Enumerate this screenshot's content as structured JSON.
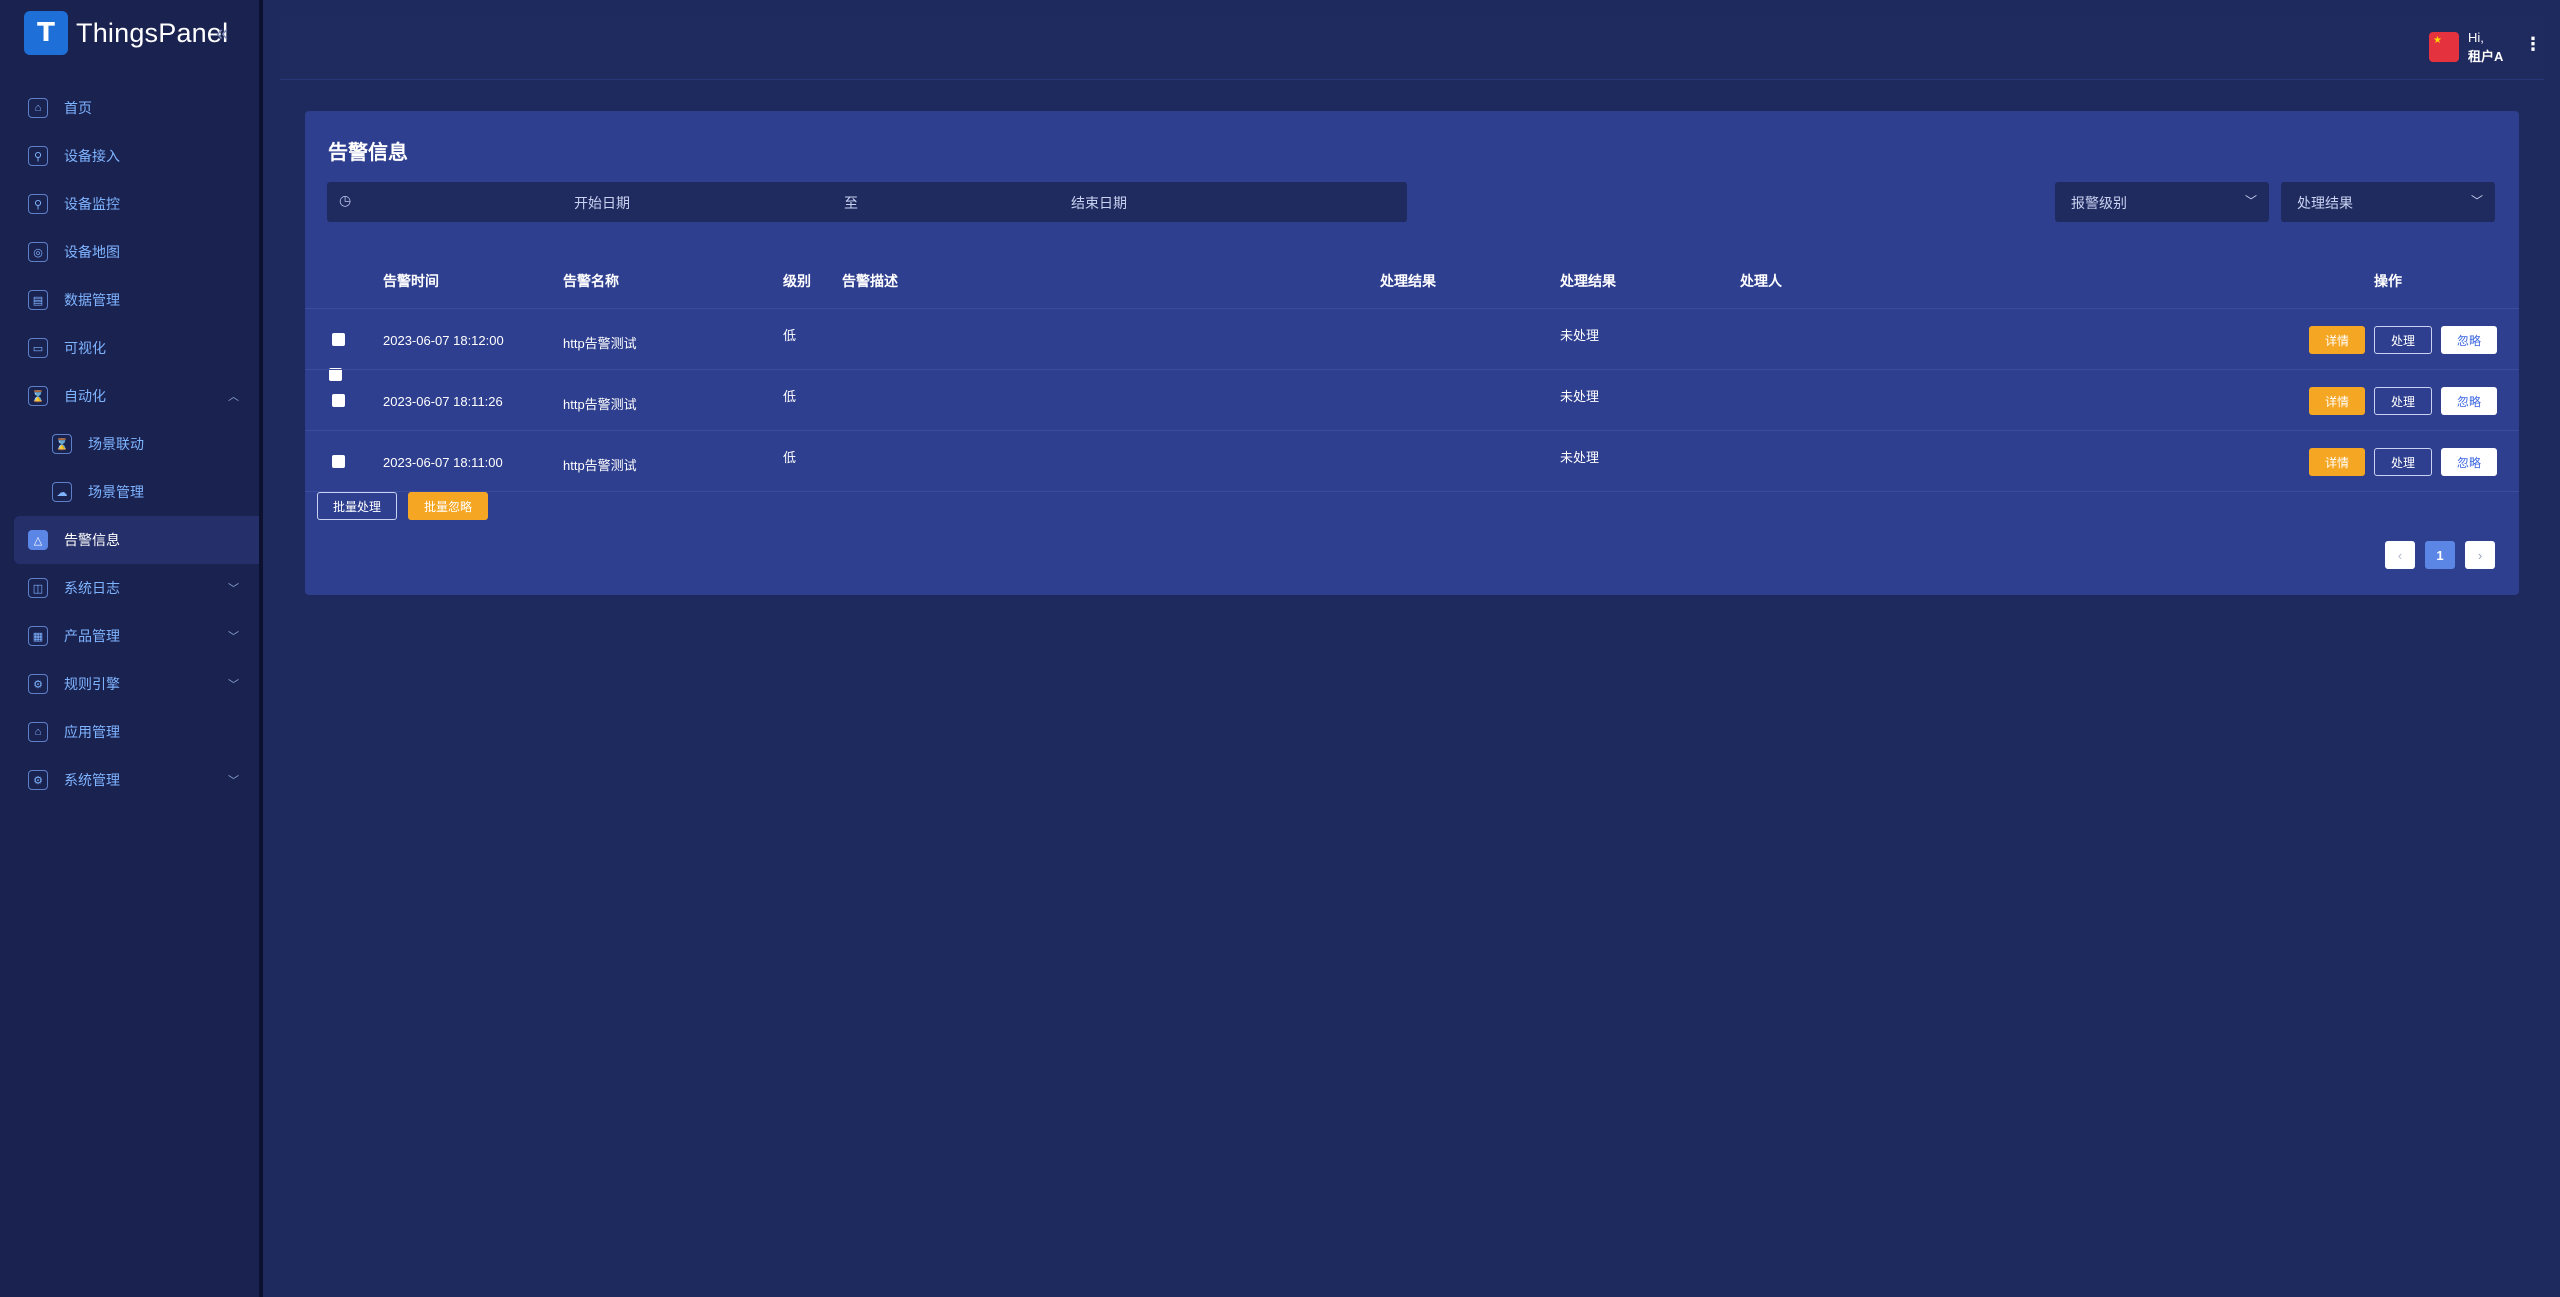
{
  "app": {
    "name": "ThingsPanel"
  },
  "sidebar": {
    "items": [
      {
        "label": "首页",
        "icon": "home-icon"
      },
      {
        "label": "设备接入",
        "icon": "device-access-icon"
      },
      {
        "label": "设备监控",
        "icon": "device-monitor-icon"
      },
      {
        "label": "设备地图",
        "icon": "map-icon"
      },
      {
        "label": "数据管理",
        "icon": "data-icon"
      },
      {
        "label": "可视化",
        "icon": "visualization-icon"
      },
      {
        "label": "自动化",
        "icon": "automation-icon",
        "expanded": true
      },
      {
        "label": "场景联动",
        "icon": "scene-linkage-icon",
        "sub": true
      },
      {
        "label": "场景管理",
        "icon": "scene-manage-icon",
        "sub": true
      },
      {
        "label": "告警信息",
        "icon": "alarm-icon",
        "active": true
      },
      {
        "label": "系统日志",
        "icon": "log-icon",
        "collapsed": true
      },
      {
        "label": "产品管理",
        "icon": "product-icon",
        "collapsed": true
      },
      {
        "label": "规则引擎",
        "icon": "rule-engine-icon",
        "collapsed": true
      },
      {
        "label": "应用管理",
        "icon": "app-manage-icon"
      },
      {
        "label": "系统管理",
        "icon": "settings-icon",
        "collapsed": true
      }
    ]
  },
  "header": {
    "greeting": "Hi,",
    "username": "租户A",
    "flag": "china-flag-icon"
  },
  "page": {
    "title": "告警信息",
    "filters": {
      "start_placeholder": "开始日期",
      "range_separator": "至",
      "end_placeholder": "结束日期",
      "level_placeholder": "报警级别",
      "result_placeholder": "处理结果"
    },
    "table": {
      "columns": [
        "告警时间",
        "告警名称",
        "级别",
        "告警描述",
        "处理结果",
        "处理结果",
        "处理人",
        "操作"
      ],
      "rows": [
        {
          "time": "2023-06-07 18:12:00",
          "name": "http告警测试",
          "level": "低",
          "description": "",
          "result1": "",
          "result2": "未处理",
          "handler": ""
        },
        {
          "time": "2023-06-07 18:11:26",
          "name": "http告警测试",
          "level": "低",
          "description": "",
          "result1": "",
          "result2": "未处理",
          "handler": ""
        },
        {
          "time": "2023-06-07 18:11:00",
          "name": "http告警测试",
          "level": "低",
          "description": "",
          "result1": "",
          "result2": "未处理",
          "handler": ""
        }
      ],
      "actions": {
        "detail": "详情",
        "handle": "处理",
        "ignore": "忽略"
      }
    },
    "bulk": {
      "handle": "批量处理",
      "ignore": "批量忽略"
    },
    "pagination": {
      "current": "1",
      "prev": "‹",
      "next": "›"
    }
  },
  "colors": {
    "background": "#1e2a5e",
    "sidebar": "#1a2250",
    "card": "#2f3f8f",
    "accent": "#5c86e6",
    "warning": "#f5a623"
  }
}
